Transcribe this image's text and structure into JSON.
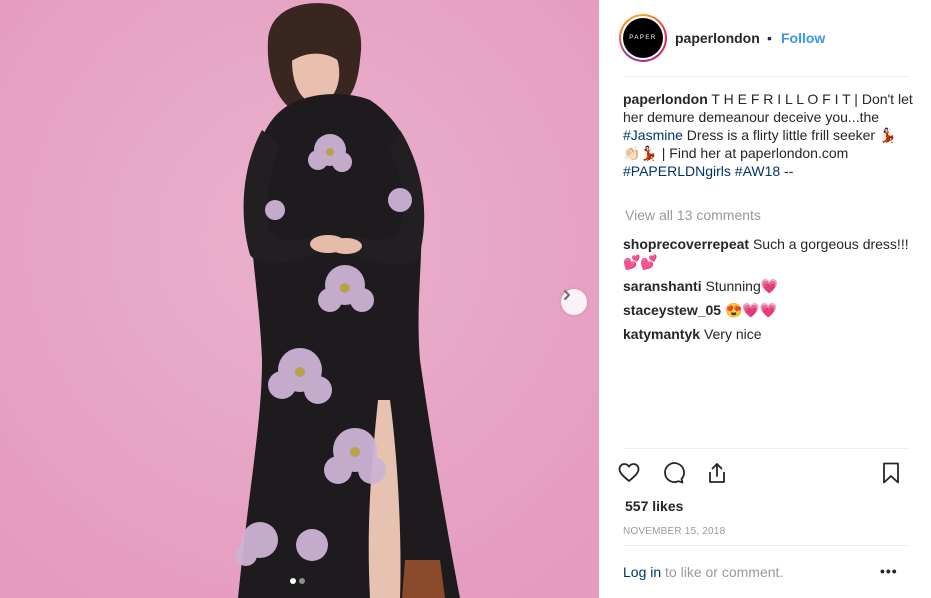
{
  "media": {
    "carousel_dots": 2,
    "active_dot": 1,
    "background_color": "#e7a6c6",
    "next_icon": "chevron-right-icon"
  },
  "header": {
    "avatar_text": "PAPER",
    "username": "paperlondon",
    "separator": "•",
    "follow_label": "Follow"
  },
  "caption": {
    "username": "paperlondon",
    "text_1": " T H E F R I L L O F I T | Don't let her demure demeanour deceive you...the ",
    "tag_1": "#Jasmine",
    "text_2": " Dress is a flirty little frill seeker 💃🏻👏🏻💃🏻 | Find her at paperlondon.com ",
    "tag_2": "#PAPERLDNgirls",
    "text_3": " ",
    "tag_3": "#AW18",
    "text_4": " --"
  },
  "view_all_comments": "View all 13 comments",
  "comments": [
    {
      "user": "shoprecoverrepeat",
      "text": "Such a gorgeous dress!!!💕💕"
    },
    {
      "user": "saranshanti",
      "text": "Stunning💗"
    },
    {
      "user": "staceystew_05",
      "text": "😍💗💗"
    },
    {
      "user": "katymantyk",
      "text": "Very nice"
    }
  ],
  "actions": {
    "like_icon": "heart-icon",
    "comment_icon": "comment-icon",
    "share_icon": "share-icon",
    "save_icon": "bookmark-icon"
  },
  "likes": "557 likes",
  "date": "NOVEMBER 15, 2018",
  "footer": {
    "login_link": "Log in",
    "login_text": " to like or comment.",
    "more_label": "•••"
  },
  "colors": {
    "link_blue": "#3897f0",
    "hashtag": "#003569",
    "muted": "#999999"
  }
}
